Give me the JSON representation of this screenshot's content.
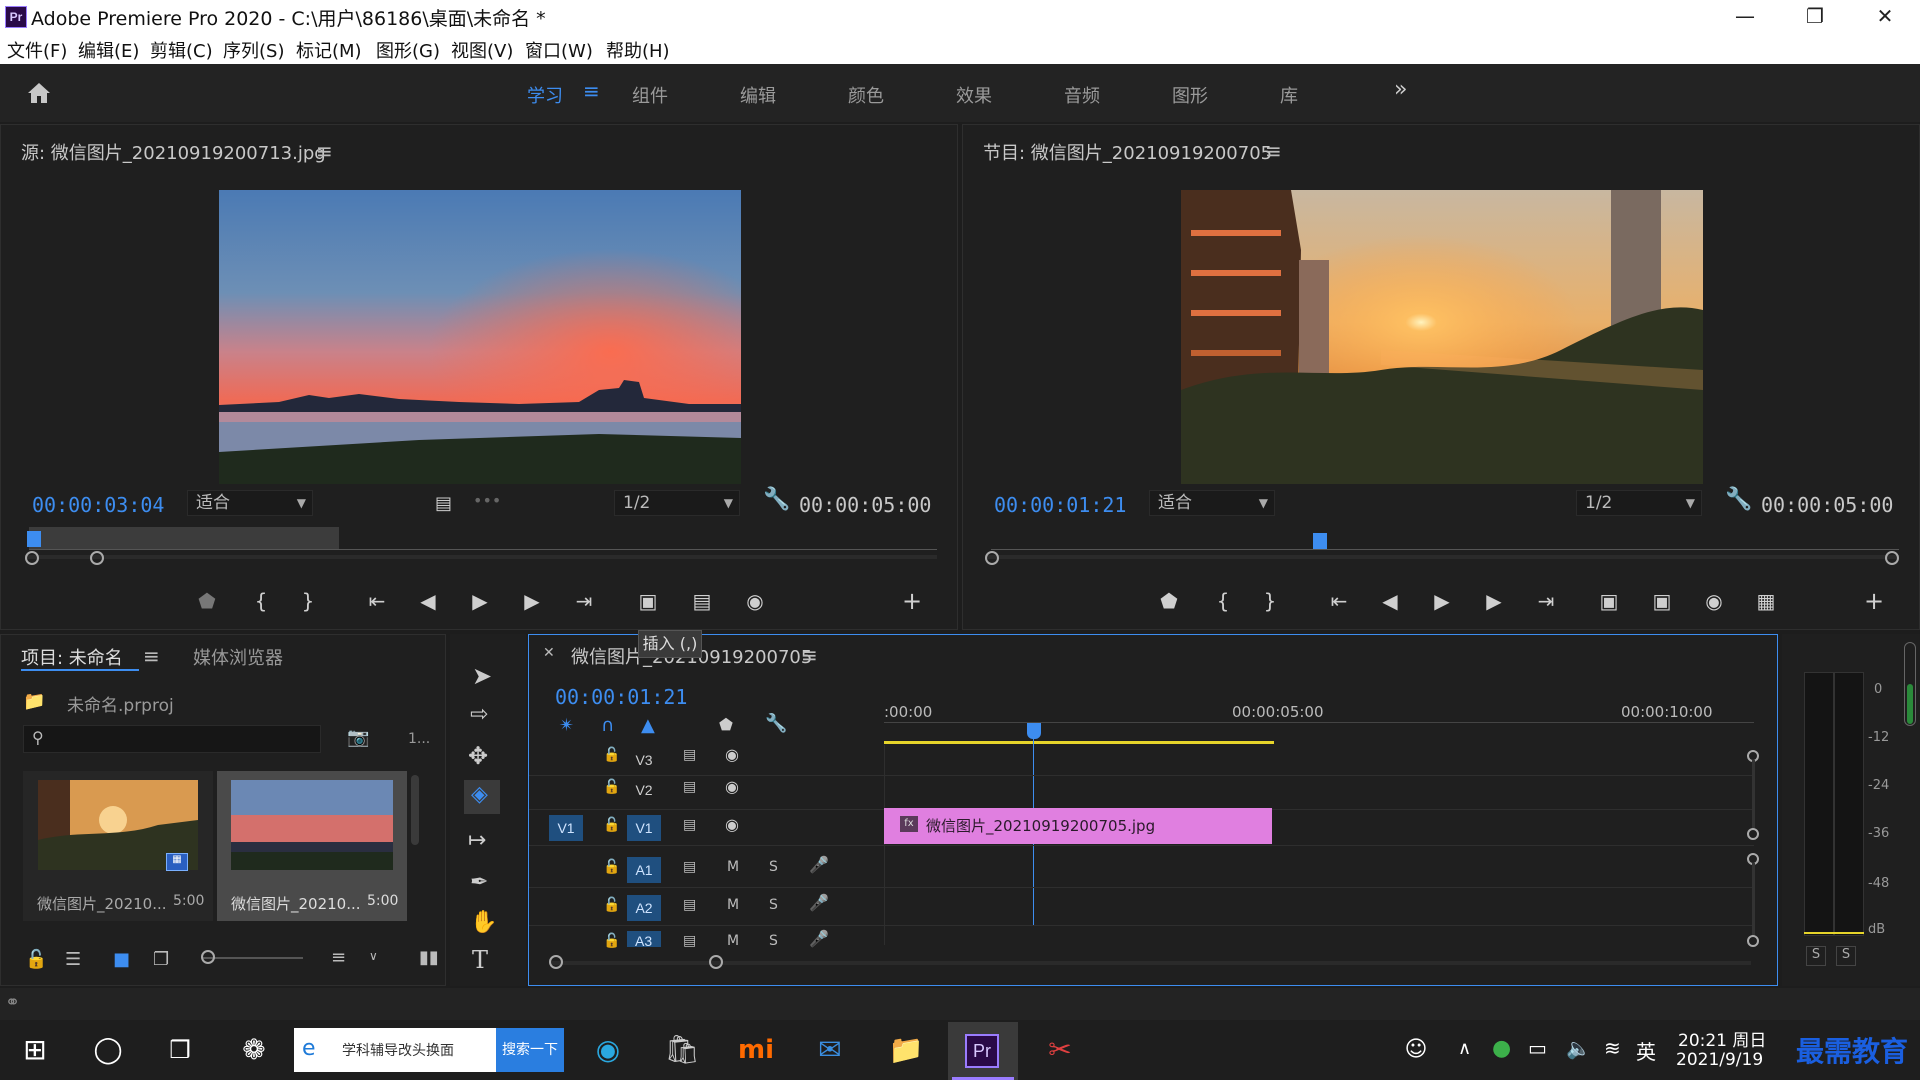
{
  "window": {
    "title": "Adobe Premiere Pro 2020 - C:\\用户\\86186\\桌面\\未命名 *",
    "app_icon": "Pr"
  },
  "menu": [
    "文件(F)",
    "编辑(E)",
    "剪辑(C)",
    "序列(S)",
    "标记(M)",
    "图形(G)",
    "视图(V)",
    "窗口(W)",
    "帮助(H)"
  ],
  "workspaces": [
    "学习",
    "组件",
    "编辑",
    "颜色",
    "效果",
    "音频",
    "图形",
    "库"
  ],
  "active_workspace": "学习",
  "source": {
    "title": "源: 微信图片_20210919200713.jpg",
    "timecode": "00:00:03:04",
    "fit": "适合",
    "resolution": "1/2",
    "duration": "00:00:05:00"
  },
  "program": {
    "title": "节目: 微信图片_20210919200705",
    "timecode": "00:00:01:21",
    "fit": "适合",
    "resolution": "1/2",
    "duration": "00:00:05:00"
  },
  "tooltip": "插入 (,)",
  "project": {
    "tab": "项目: 未命名",
    "tab2": "媒体浏览器",
    "file": "未命名.prproj",
    "count": "1...",
    "items": [
      {
        "name": "微信图片_20210...",
        "duration": "5:00"
      },
      {
        "name": "微信图片_20210...",
        "duration": "5:00"
      }
    ]
  },
  "timeline": {
    "title": "微信图片_20210919200705",
    "timecode": "00:00:01:21",
    "ruler": [
      ":00:00",
      "00:00:05:00",
      "00:00:10:00"
    ],
    "tracks": {
      "video": [
        "V3",
        "V2",
        "V1"
      ],
      "audio": [
        "A1",
        "A2",
        "A3"
      ],
      "source_patch": "V1",
      "mute": "M",
      "solo": "S"
    },
    "clip": "微信图片_20210919200705.jpg",
    "clip_fx": "fx"
  },
  "meter": {
    "scale": [
      "0",
      "-12",
      "-24",
      "-36",
      "-48",
      "dB"
    ],
    "solo_left": "S",
    "solo_right": "S"
  },
  "taskbar": {
    "search_text": "学科辅导改头换面",
    "search_button": "搜索一下",
    "ime": "英",
    "time": "20:21 周日",
    "date": "2021/9/19",
    "watermark": "最需教育"
  },
  "colors": {
    "accent": "#3d8df0",
    "clip": "#e07fe0",
    "workarea": "#e6d42a"
  }
}
